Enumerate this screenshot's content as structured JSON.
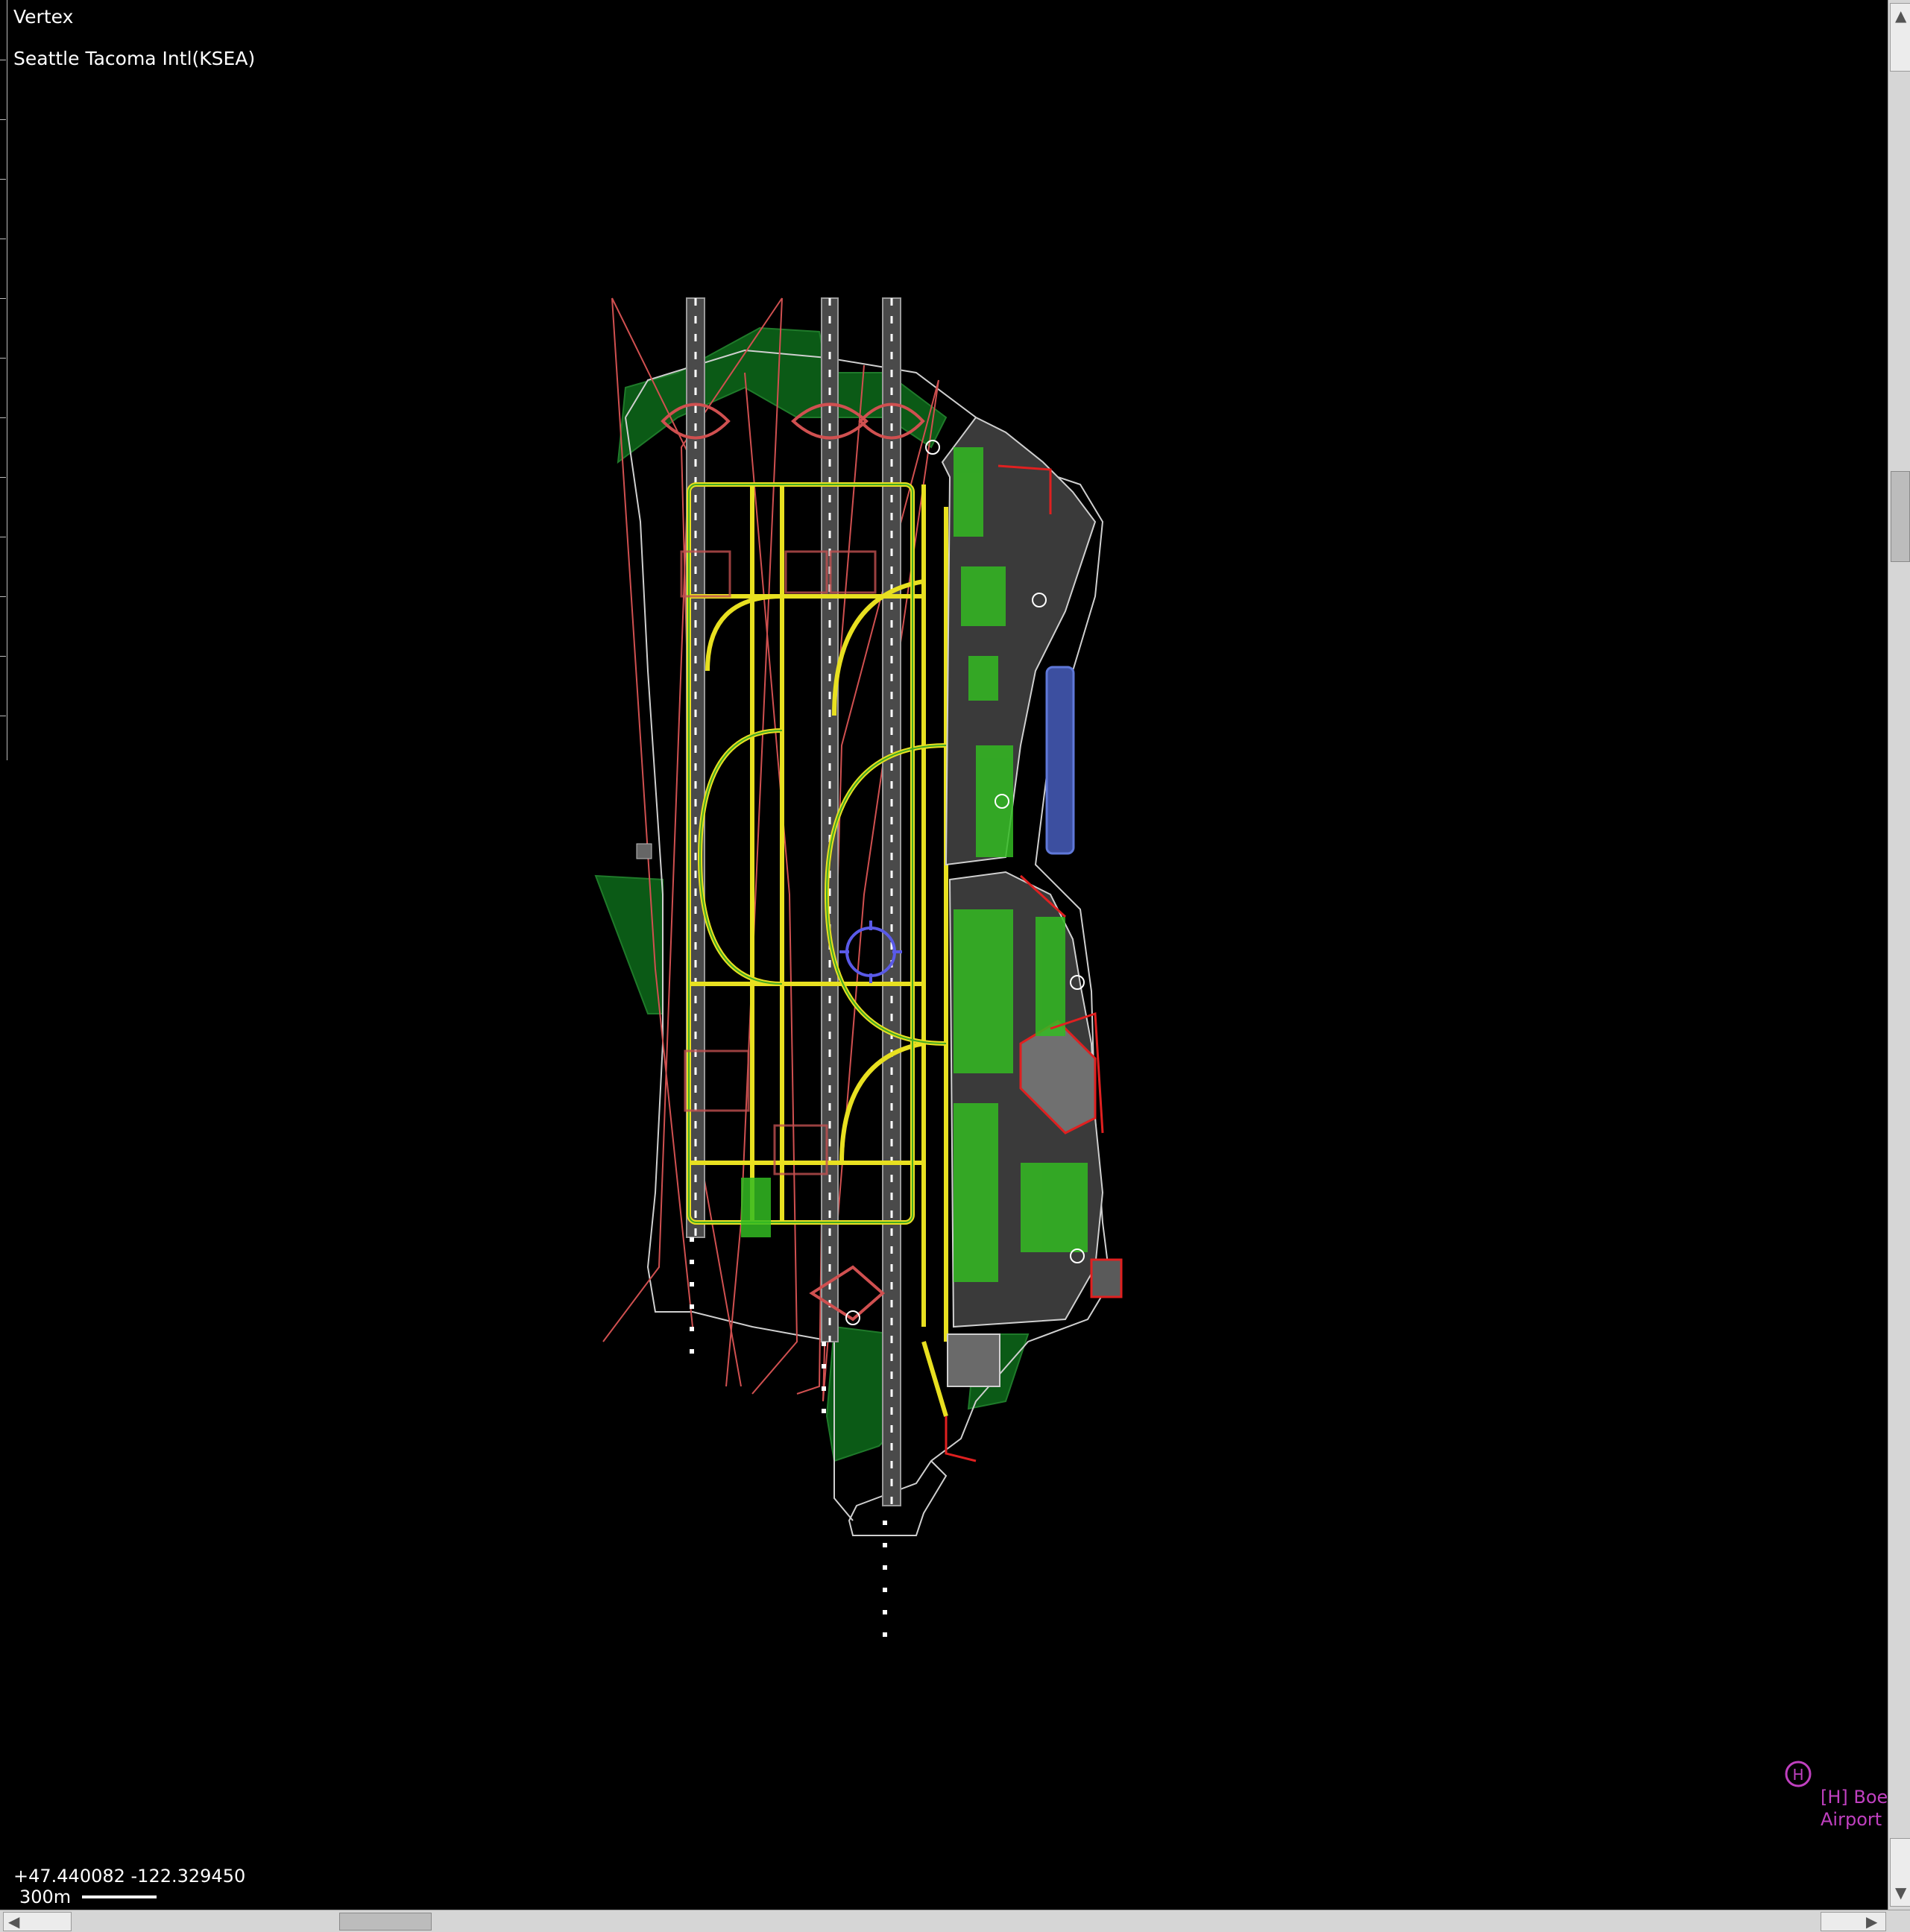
{
  "toolbar": {
    "tool_name": "Vertex"
  },
  "airport": {
    "name": "Seattle Tacoma Intl(KSEA)"
  },
  "status": {
    "coordinates": "+47.440082 -122.329450",
    "scale": "300m"
  },
  "heliport": {
    "label": "[H] Boe\nAirport",
    "icon": "heliport-icon"
  },
  "colors": {
    "background": "#000000",
    "runway": "#9a9a9a",
    "taxiway_line": "#e8e020",
    "grass": "#0b5a16",
    "boundary": "#c05050",
    "building": "#606060",
    "vegetation": "#33bb22",
    "heliport": "#c040c0"
  }
}
